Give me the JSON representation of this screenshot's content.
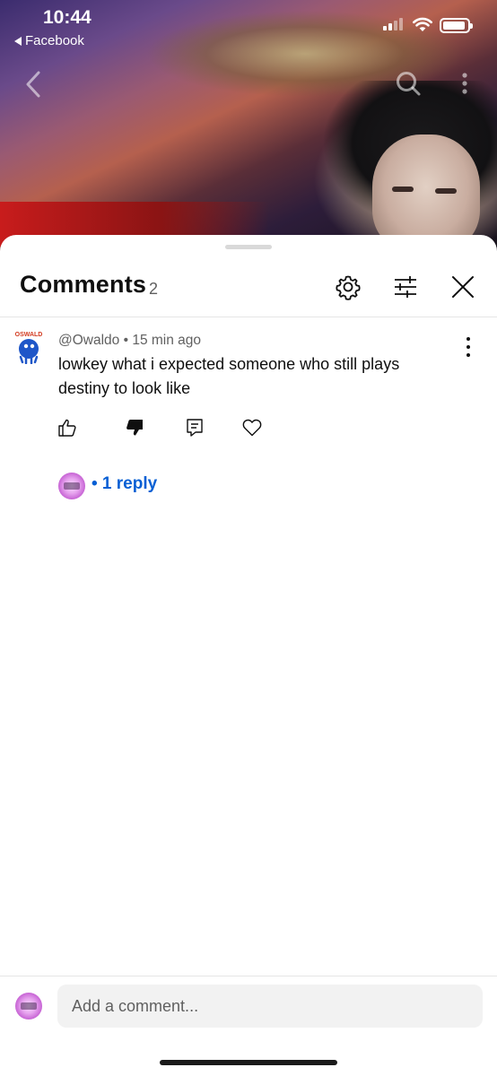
{
  "status_bar": {
    "time": "10:44",
    "back_app": "Facebook"
  },
  "comments_panel": {
    "title": "Comments",
    "count": "2",
    "icons": [
      "gear-icon",
      "sliders-icon",
      "close-icon"
    ]
  },
  "comments": [
    {
      "author": "@Owaldo",
      "time": "15 min ago",
      "meta": "@Owaldo • 15 min ago",
      "text": "lowkey what i expected someone who still plays destiny to look like",
      "avatar_label": "OSWALD",
      "replies_label": "• 1 reply"
    }
  ],
  "composer": {
    "placeholder": "Add a comment..."
  },
  "colors": {
    "accent_link": "#065fd4",
    "text_primary": "#0f0f0f",
    "text_secondary": "#606060",
    "input_bg": "#f2f2f2"
  }
}
